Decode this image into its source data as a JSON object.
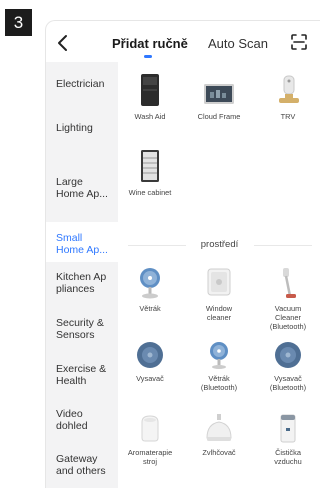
{
  "step_number": "3",
  "header": {
    "tab_manual": "Přidat ručně",
    "tab_auto": "Auto Scan"
  },
  "sidebar": {
    "items": [
      {
        "label": "Electrician"
      },
      {
        "label": "Lighting"
      },
      {
        "label": "Large\nHome Ap..."
      },
      {
        "label": "Small\nHome Ap...",
        "active": true
      },
      {
        "label": "Kitchen Ap\npliances"
      },
      {
        "label": "Security &\nSensors"
      },
      {
        "label": "Exercise &\nHealth"
      },
      {
        "label": "Video\ndohled"
      },
      {
        "label": "Gateway\nand others"
      }
    ]
  },
  "large_appliances": [
    {
      "label": "Wash Aid",
      "icon": "wash-aid-icon"
    },
    {
      "label": "Cloud Frame",
      "icon": "cloud-frame-icon"
    },
    {
      "label": "TRV",
      "icon": "trv-icon"
    },
    {
      "label": "Wine cabinet",
      "icon": "wine-cabinet-icon"
    }
  ],
  "section_title": "prostředí",
  "environment_devices": [
    {
      "label": "Větrák",
      "icon": "fan-icon"
    },
    {
      "label": "Window\ncleaner",
      "icon": "window-cleaner-icon"
    },
    {
      "label": "Vacuum\nCleaner\n(Bluetooth)",
      "icon": "stick-vacuum-icon"
    },
    {
      "label": "Vysavač",
      "icon": "robot-vacuum-icon"
    },
    {
      "label": "Větrák\n(Bluetooth)",
      "icon": "fan-bluetooth-icon"
    },
    {
      "label": "Vysavač\n(Bluetooth)",
      "icon": "robot-vacuum-bluetooth-icon"
    },
    {
      "label": "Aromaterapie\nstroj",
      "icon": "aroma-diffuser-icon"
    },
    {
      "label": "Zvlhčovač",
      "icon": "humidifier-icon"
    },
    {
      "label": "Čistička\nvzduchu",
      "icon": "air-purifier-icon"
    }
  ],
  "colors": {
    "accent": "#2f78ff",
    "sidebar_bg": "#f3f3f4",
    "robot_vacuum": "#5a7fa8"
  }
}
